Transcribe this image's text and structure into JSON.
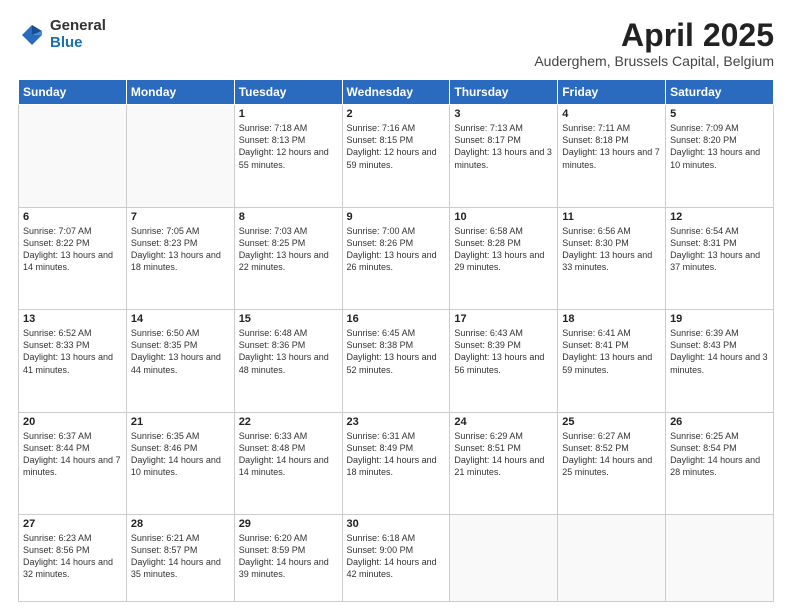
{
  "header": {
    "logo_general": "General",
    "logo_blue": "Blue",
    "title": "April 2025",
    "subtitle": "Auderghem, Brussels Capital, Belgium"
  },
  "days_of_week": [
    "Sunday",
    "Monday",
    "Tuesday",
    "Wednesday",
    "Thursday",
    "Friday",
    "Saturday"
  ],
  "weeks": [
    [
      {
        "day": "",
        "info": ""
      },
      {
        "day": "",
        "info": ""
      },
      {
        "day": "1",
        "info": "Sunrise: 7:18 AM\nSunset: 8:13 PM\nDaylight: 12 hours and 55 minutes."
      },
      {
        "day": "2",
        "info": "Sunrise: 7:16 AM\nSunset: 8:15 PM\nDaylight: 12 hours and 59 minutes."
      },
      {
        "day": "3",
        "info": "Sunrise: 7:13 AM\nSunset: 8:17 PM\nDaylight: 13 hours and 3 minutes."
      },
      {
        "day": "4",
        "info": "Sunrise: 7:11 AM\nSunset: 8:18 PM\nDaylight: 13 hours and 7 minutes."
      },
      {
        "day": "5",
        "info": "Sunrise: 7:09 AM\nSunset: 8:20 PM\nDaylight: 13 hours and 10 minutes."
      }
    ],
    [
      {
        "day": "6",
        "info": "Sunrise: 7:07 AM\nSunset: 8:22 PM\nDaylight: 13 hours and 14 minutes."
      },
      {
        "day": "7",
        "info": "Sunrise: 7:05 AM\nSunset: 8:23 PM\nDaylight: 13 hours and 18 minutes."
      },
      {
        "day": "8",
        "info": "Sunrise: 7:03 AM\nSunset: 8:25 PM\nDaylight: 13 hours and 22 minutes."
      },
      {
        "day": "9",
        "info": "Sunrise: 7:00 AM\nSunset: 8:26 PM\nDaylight: 13 hours and 26 minutes."
      },
      {
        "day": "10",
        "info": "Sunrise: 6:58 AM\nSunset: 8:28 PM\nDaylight: 13 hours and 29 minutes."
      },
      {
        "day": "11",
        "info": "Sunrise: 6:56 AM\nSunset: 8:30 PM\nDaylight: 13 hours and 33 minutes."
      },
      {
        "day": "12",
        "info": "Sunrise: 6:54 AM\nSunset: 8:31 PM\nDaylight: 13 hours and 37 minutes."
      }
    ],
    [
      {
        "day": "13",
        "info": "Sunrise: 6:52 AM\nSunset: 8:33 PM\nDaylight: 13 hours and 41 minutes."
      },
      {
        "day": "14",
        "info": "Sunrise: 6:50 AM\nSunset: 8:35 PM\nDaylight: 13 hours and 44 minutes."
      },
      {
        "day": "15",
        "info": "Sunrise: 6:48 AM\nSunset: 8:36 PM\nDaylight: 13 hours and 48 minutes."
      },
      {
        "day": "16",
        "info": "Sunrise: 6:45 AM\nSunset: 8:38 PM\nDaylight: 13 hours and 52 minutes."
      },
      {
        "day": "17",
        "info": "Sunrise: 6:43 AM\nSunset: 8:39 PM\nDaylight: 13 hours and 56 minutes."
      },
      {
        "day": "18",
        "info": "Sunrise: 6:41 AM\nSunset: 8:41 PM\nDaylight: 13 hours and 59 minutes."
      },
      {
        "day": "19",
        "info": "Sunrise: 6:39 AM\nSunset: 8:43 PM\nDaylight: 14 hours and 3 minutes."
      }
    ],
    [
      {
        "day": "20",
        "info": "Sunrise: 6:37 AM\nSunset: 8:44 PM\nDaylight: 14 hours and 7 minutes."
      },
      {
        "day": "21",
        "info": "Sunrise: 6:35 AM\nSunset: 8:46 PM\nDaylight: 14 hours and 10 minutes."
      },
      {
        "day": "22",
        "info": "Sunrise: 6:33 AM\nSunset: 8:48 PM\nDaylight: 14 hours and 14 minutes."
      },
      {
        "day": "23",
        "info": "Sunrise: 6:31 AM\nSunset: 8:49 PM\nDaylight: 14 hours and 18 minutes."
      },
      {
        "day": "24",
        "info": "Sunrise: 6:29 AM\nSunset: 8:51 PM\nDaylight: 14 hours and 21 minutes."
      },
      {
        "day": "25",
        "info": "Sunrise: 6:27 AM\nSunset: 8:52 PM\nDaylight: 14 hours and 25 minutes."
      },
      {
        "day": "26",
        "info": "Sunrise: 6:25 AM\nSunset: 8:54 PM\nDaylight: 14 hours and 28 minutes."
      }
    ],
    [
      {
        "day": "27",
        "info": "Sunrise: 6:23 AM\nSunset: 8:56 PM\nDaylight: 14 hours and 32 minutes."
      },
      {
        "day": "28",
        "info": "Sunrise: 6:21 AM\nSunset: 8:57 PM\nDaylight: 14 hours and 35 minutes."
      },
      {
        "day": "29",
        "info": "Sunrise: 6:20 AM\nSunset: 8:59 PM\nDaylight: 14 hours and 39 minutes."
      },
      {
        "day": "30",
        "info": "Sunrise: 6:18 AM\nSunset: 9:00 PM\nDaylight: 14 hours and 42 minutes."
      },
      {
        "day": "",
        "info": ""
      },
      {
        "day": "",
        "info": ""
      },
      {
        "day": "",
        "info": ""
      }
    ]
  ]
}
